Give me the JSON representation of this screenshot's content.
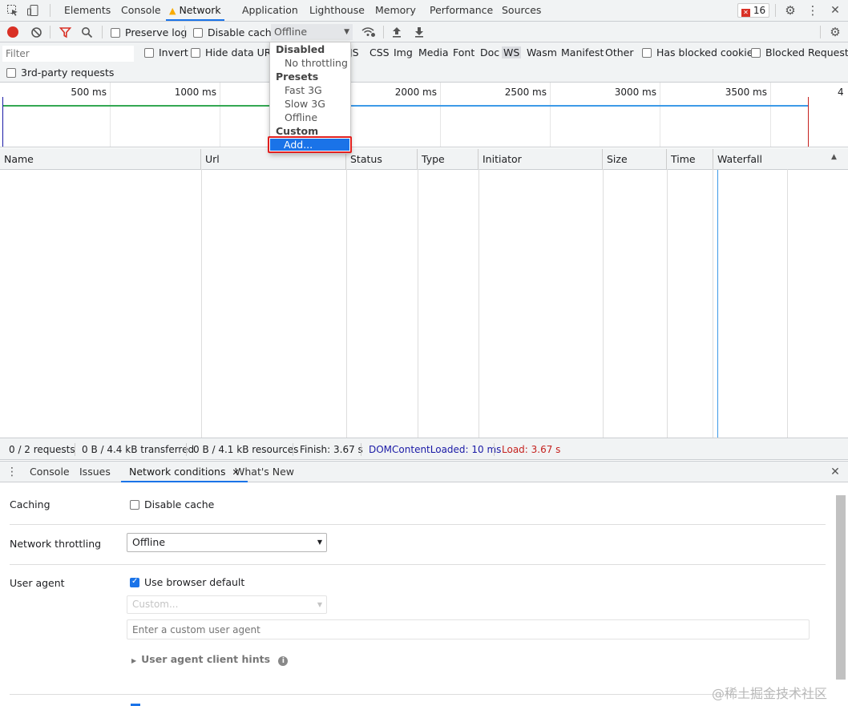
{
  "top_tabs": {
    "elements": "Elements",
    "console": "Console",
    "network": "Network",
    "application": "Application",
    "lighthouse": "Lighthouse",
    "memory": "Memory",
    "performance": "Performance",
    "sources": "Sources"
  },
  "issues_count": "16",
  "toolbar": {
    "preserve_log": "Preserve log",
    "disable_cache": "Disable cache",
    "throttle_value": "Offline"
  },
  "filter": {
    "placeholder": "Filter",
    "invert": "Invert",
    "hide_data_urls": "Hide data URLs",
    "types": [
      "JS",
      "CSS",
      "Img",
      "Media",
      "Font",
      "Doc",
      "WS",
      "Wasm",
      "Manifest",
      "Other"
    ],
    "has_blocked_cookies": "Has blocked cookies",
    "blocked_requests": "Blocked Requests",
    "third_party": "3rd-party requests"
  },
  "timeline_ticks": [
    "500 ms",
    "1000 ms",
    "2000 ms",
    "2500 ms",
    "3000 ms",
    "3500 ms",
    "4"
  ],
  "dropdown": {
    "disabled_header": "Disabled",
    "no_throttling": "No throttling",
    "presets_header": "Presets",
    "fast3g": "Fast 3G",
    "slow3g": "Slow 3G",
    "offline": "Offline",
    "custom_header": "Custom",
    "add": "Add..."
  },
  "columns": [
    "Name",
    "Url",
    "Status",
    "Type",
    "Initiator",
    "Size",
    "Time",
    "Waterfall"
  ],
  "status_bar": {
    "requests": "0 / 2 requests",
    "transferred": "0 B / 4.4 kB transferred",
    "resources": "0 B / 4.1 kB resources",
    "finish": "Finish: 3.67 s",
    "dcl": "DOMContentLoaded: 10 ms",
    "load": "Load: 3.67 s"
  },
  "drawer_tabs": {
    "console": "Console",
    "issues": "Issues",
    "network_conditions": "Network conditions",
    "whats_new": "What's New"
  },
  "conditions": {
    "caching_label": "Caching",
    "disable_cache": "Disable cache",
    "throttling_label": "Network throttling",
    "throttling_value": "Offline",
    "ua_label": "User agent",
    "use_default": "Use browser default",
    "custom_select": "Custom...",
    "custom_placeholder": "Enter a custom user agent",
    "client_hints": "User agent client hints"
  },
  "watermark": "@稀土掘金技术社区",
  "colors": {
    "accent": "#1a73e8",
    "record": "#d93025",
    "load": "#c5221f",
    "dcl": "#1a1aa6",
    "highlight": "#1a73e8"
  }
}
